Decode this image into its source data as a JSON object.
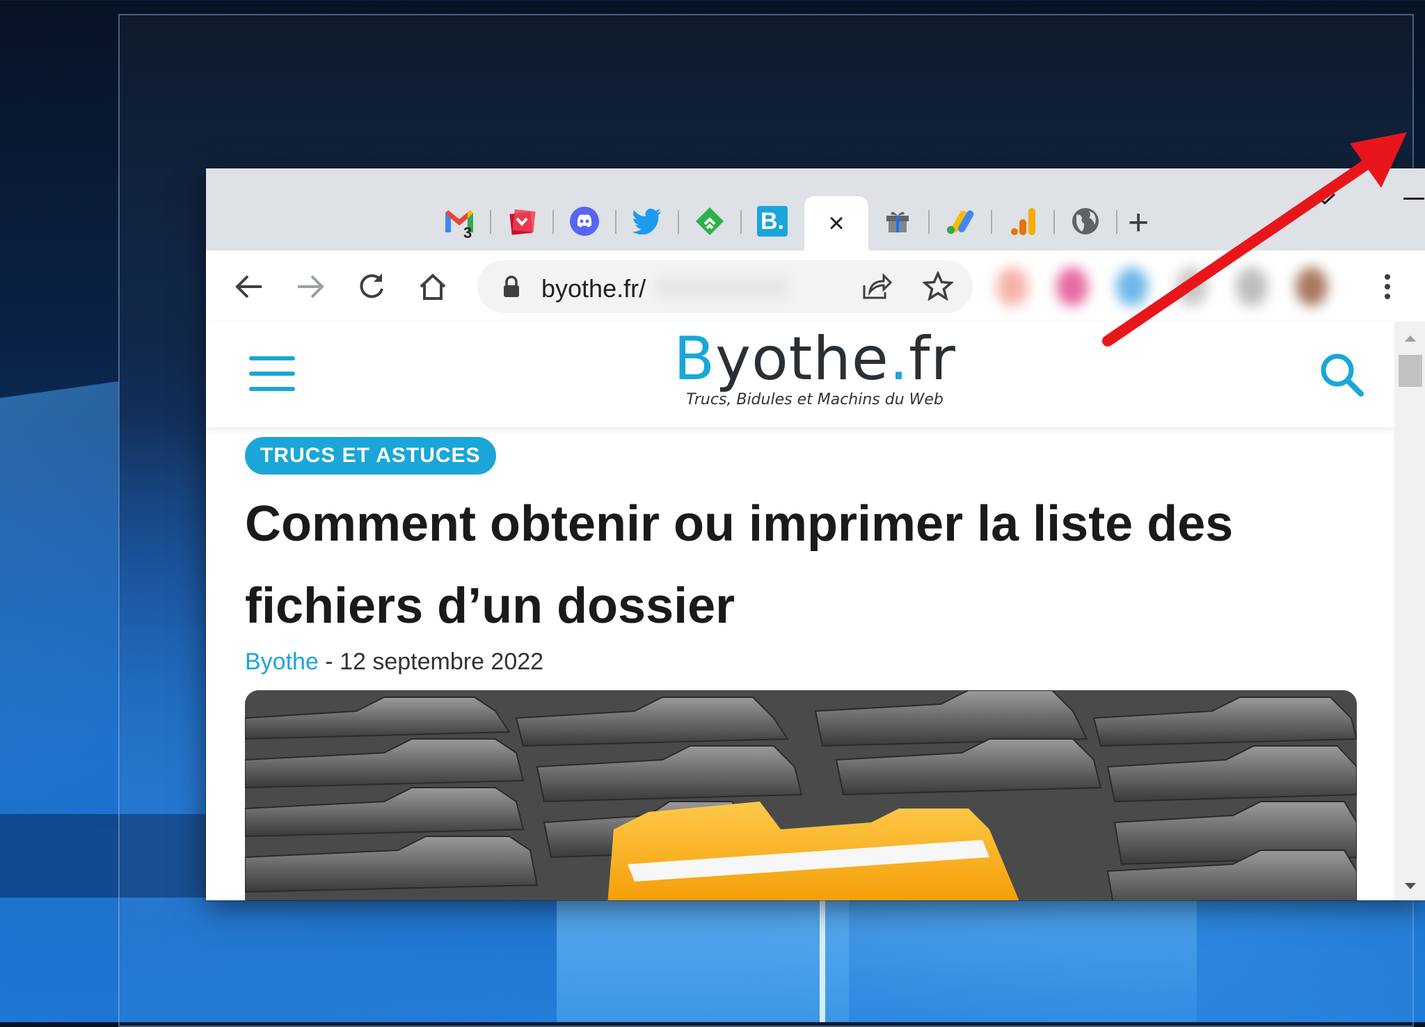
{
  "desktop": {
    "wallpaper": "windows-10-blue"
  },
  "browser": {
    "tabs": [
      {
        "name": "gmail",
        "badge": "3"
      },
      {
        "name": "pocket"
      },
      {
        "name": "discord"
      },
      {
        "name": "twitter"
      },
      {
        "name": "feedly"
      },
      {
        "name": "byothe",
        "letter": "B."
      },
      {
        "name": "active-tab",
        "close_label": "×"
      },
      {
        "name": "gift-lock"
      },
      {
        "name": "google-ads"
      },
      {
        "name": "google-analytics"
      },
      {
        "name": "globe"
      }
    ],
    "new_tab_label": "+",
    "address": {
      "url": "byothe.fr/"
    }
  },
  "site": {
    "logo": {
      "b": "B",
      "main": "yothe",
      "dot": ".",
      "tld": "fr",
      "tagline": "Trucs, Bidules et Machins du Web"
    },
    "category": "TRUCS ET ASTUCES",
    "title": "Comment obtenir ou imprimer la liste des fichiers d’un dossier",
    "author": "Byothe",
    "date": " - 12 septembre 2022"
  },
  "colors": {
    "accent": "#1aa6d9",
    "arrow": "#e8161b"
  }
}
